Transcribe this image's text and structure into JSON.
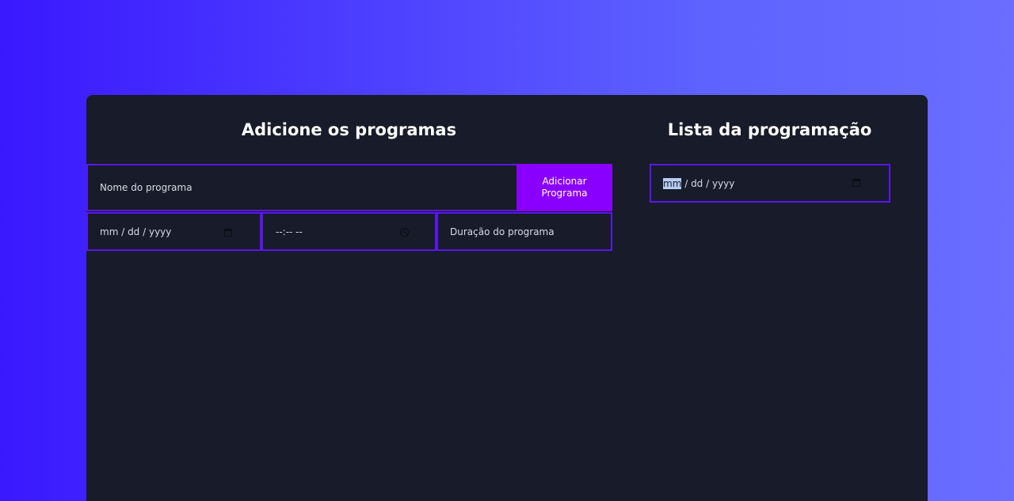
{
  "add_section": {
    "title": "Adicione os programas",
    "name_placeholder": "Nome do programa",
    "add_button_label": "Adicionar Programa",
    "date_segments": {
      "month": "mm",
      "sep1": " / ",
      "day": "dd",
      "sep2": " / ",
      "year": "yyyy"
    },
    "time_value": "--:-- --",
    "duration_placeholder": "Duração do programa"
  },
  "list_section": {
    "title": "Lista da programação",
    "date_segments": {
      "month": "mm",
      "sep1": " / ",
      "day": "dd",
      "sep2": " / ",
      "year": "yyyy"
    }
  },
  "colors": {
    "background_gradient_start": "#3a18ff",
    "background_gradient_end": "#6a6dff",
    "card": "#181b29",
    "border_accent": "#5a16ee",
    "button": "#8a00ff"
  },
  "icons": {
    "date": "calendar-icon",
    "time": "clock-icon"
  }
}
